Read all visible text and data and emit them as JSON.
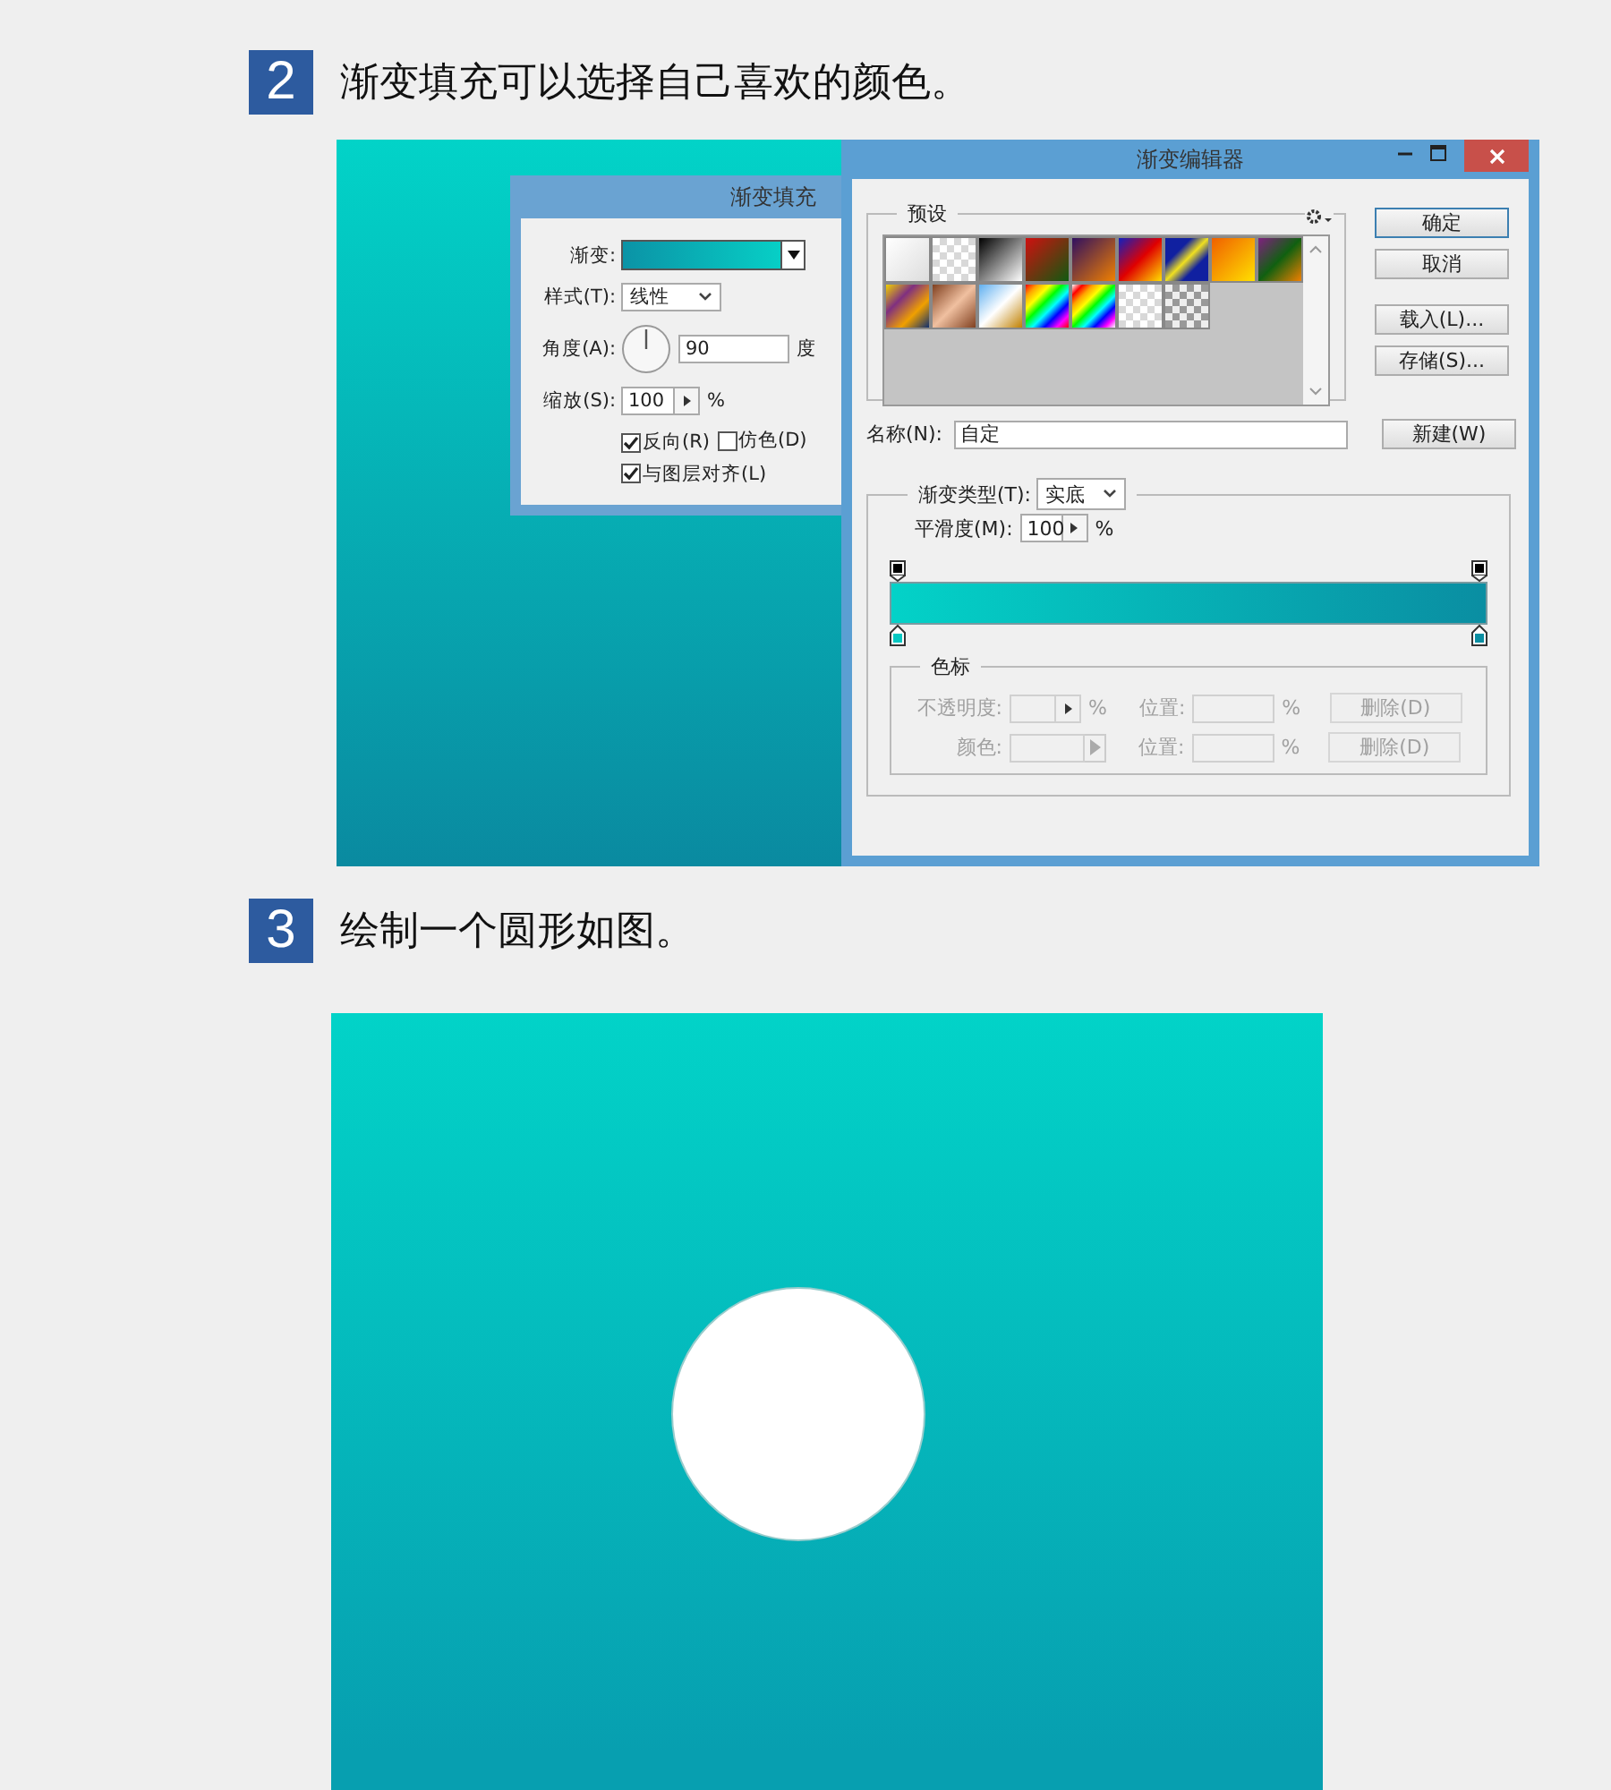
{
  "steps": [
    {
      "number": "2",
      "text": "渐变填充可以选择自己喜欢的颜色。",
      "panel": {
        "kind": "dialogs",
        "gradient_fill_dialog": {
          "title": "渐变填充",
          "gradient_label": "渐变:",
          "style_label": "样式(T):",
          "style_value": "线性",
          "angle_label": "角度(A):",
          "angle_value": "90",
          "angle_unit": "度",
          "scale_label": "缩放(S):",
          "scale_value": "100",
          "scale_unit": "%",
          "checkboxes": [
            {
              "label": "反向(R)",
              "checked": true
            },
            {
              "label": "仿色(D)",
              "checked": false
            },
            {
              "label": "与图层对齐(L)",
              "checked": true
            }
          ]
        },
        "gradient_editor": {
          "title": "渐变编辑器",
          "presets_label": "预设",
          "buttons": [
            "确定",
            "取消",
            "载入(L)...",
            "存储(S)..."
          ],
          "name_label": "名称(N):",
          "name_value": "自定",
          "new_button": "新建(W)",
          "type_label": "渐变类型(T):",
          "type_value": "实底",
          "smoothness_label": "平滑度(M):",
          "smoothness_value": "100",
          "smoothness_unit": "%",
          "stops_label": "色标",
          "stop_rows": [
            {
              "kind": "opacity",
              "label": "不透明度:",
              "unit": "%",
              "position_label": "位置:",
              "position_unit": "%",
              "delete_button": "删除(D)",
              "disabled": true
            },
            {
              "kind": "color",
              "label": "颜色:",
              "position_label": "位置:",
              "position_unit": "%",
              "delete_button": "删除(D)",
              "disabled": true
            }
          ]
        }
      }
    },
    {
      "number": "3",
      "text": "绘制一个圆形如图。",
      "panel": {
        "kind": "canvas"
      }
    }
  ]
}
